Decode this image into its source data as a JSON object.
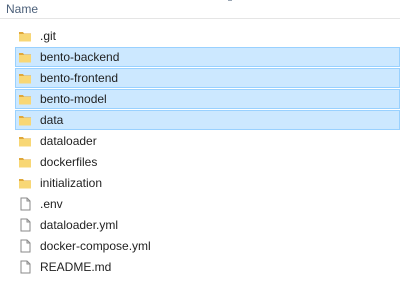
{
  "header": {
    "column_name": "Name"
  },
  "colors": {
    "selection_bg": "#cce8ff",
    "selection_border": "#99d1ff",
    "folder": "#f8d775",
    "folder_dark": "#e0a83a"
  },
  "files": [
    {
      "name": ".git",
      "type": "folder",
      "selected": false
    },
    {
      "name": "bento-backend",
      "type": "folder",
      "selected": true
    },
    {
      "name": "bento-frontend",
      "type": "folder",
      "selected": true
    },
    {
      "name": "bento-model",
      "type": "folder",
      "selected": true
    },
    {
      "name": "data",
      "type": "folder",
      "selected": true
    },
    {
      "name": "dataloader",
      "type": "folder",
      "selected": false
    },
    {
      "name": "dockerfiles",
      "type": "folder",
      "selected": false
    },
    {
      "name": "initialization",
      "type": "folder",
      "selected": false
    },
    {
      "name": ".env",
      "type": "file",
      "selected": false
    },
    {
      "name": "dataloader.yml",
      "type": "file",
      "selected": false
    },
    {
      "name": "docker-compose.yml",
      "type": "file",
      "selected": false
    },
    {
      "name": "README.md",
      "type": "file",
      "selected": false
    }
  ]
}
